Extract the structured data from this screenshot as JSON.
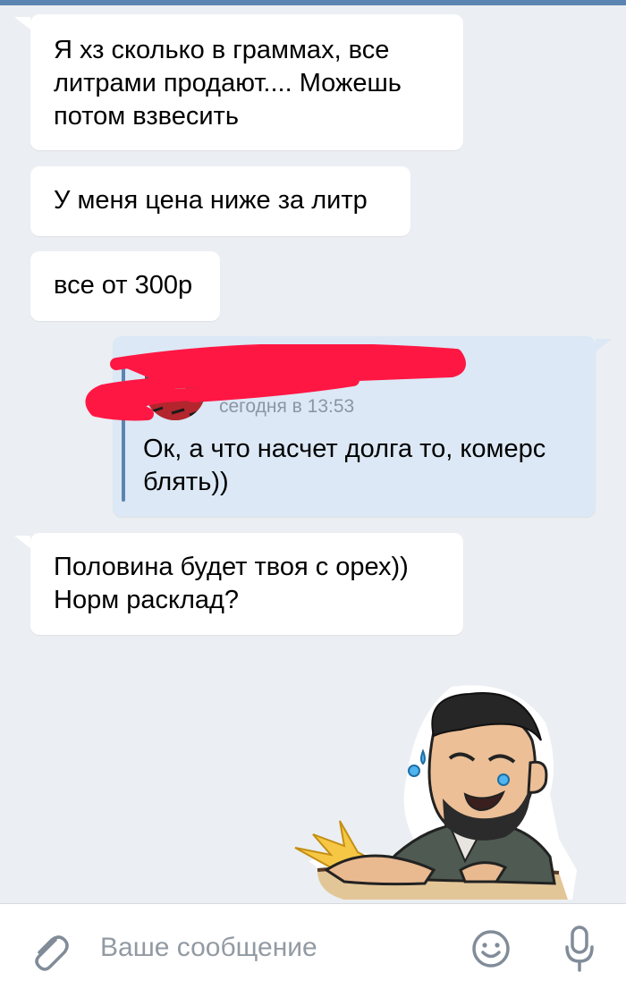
{
  "messages": [
    {
      "direction": "in",
      "text": "Я хз сколько в граммах, все\nлитрами продают.... Можешь\nпотом взвесить"
    },
    {
      "direction": "in",
      "text": "У меня цена ниже за литр"
    },
    {
      "direction": "in",
      "text": "все от 300р"
    },
    {
      "direction": "out",
      "forwarded": {
        "time": "сегодня в 13:53",
        "text": "Ок, а что насчет долга то, комерс\nблять))"
      }
    },
    {
      "direction": "in",
      "text": "Половина будет твоя с орех))\nНорм расклад?"
    }
  ],
  "composer": {
    "placeholder": "Ваше сообщение",
    "icons": [
      "paperclip-icon",
      "emoji-icon",
      "microphone-icon"
    ]
  },
  "colors": {
    "background": "#ebeef2",
    "incoming_bubble": "#ffffff",
    "outgoing_bubble": "#dce8f5",
    "accent": "#5b84b1",
    "redaction": "#ff1744"
  }
}
